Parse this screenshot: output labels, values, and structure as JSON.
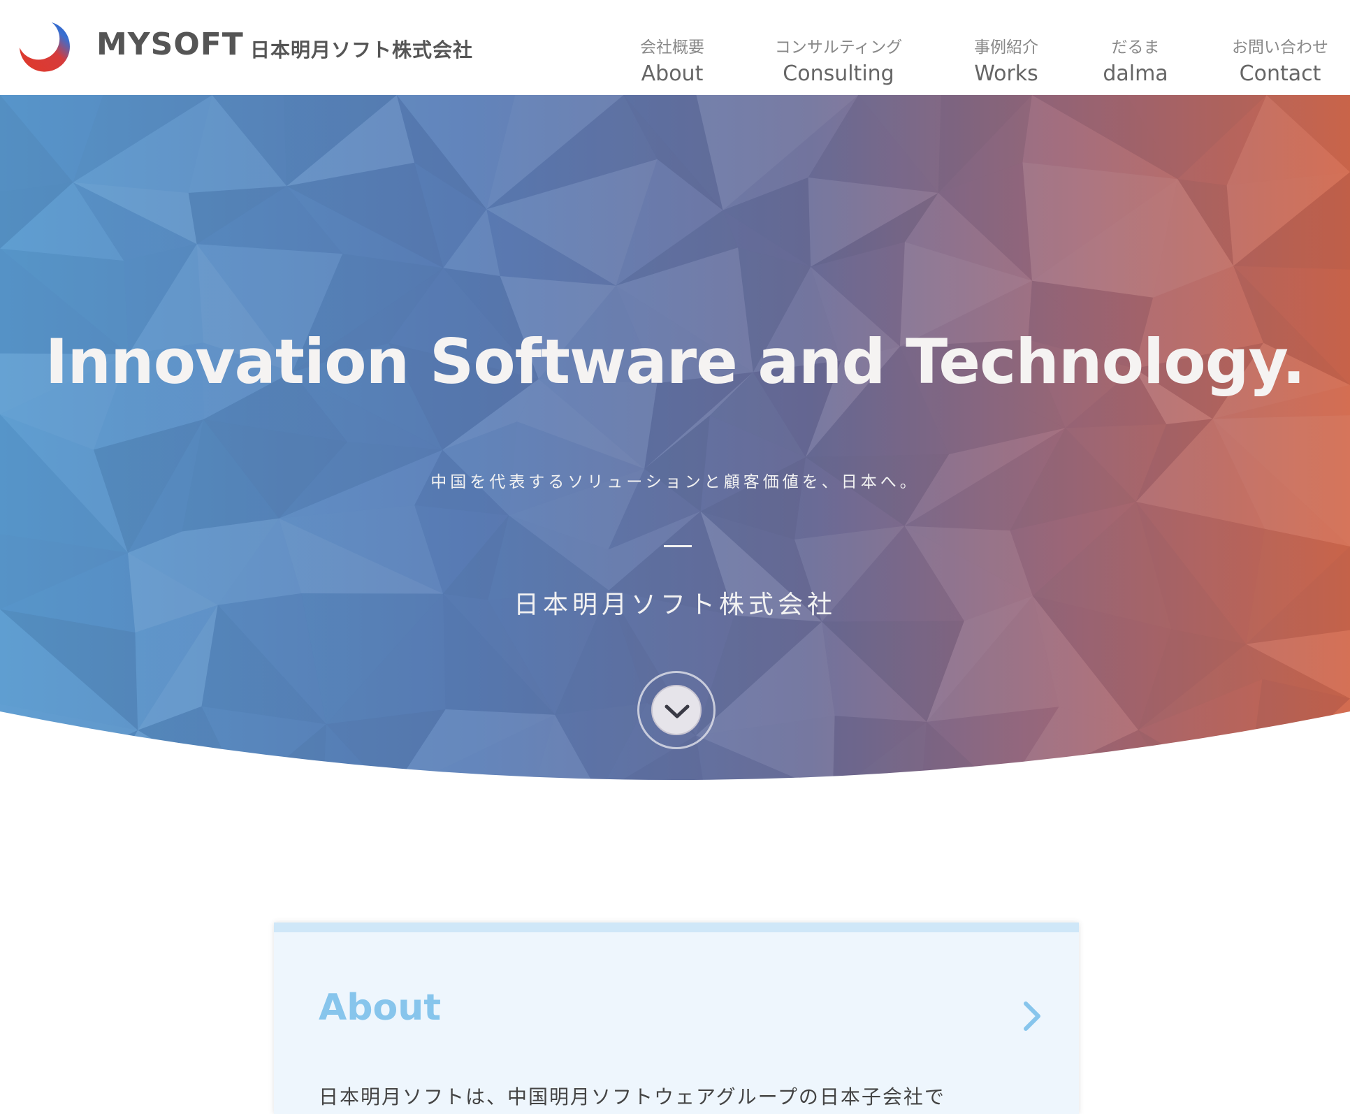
{
  "header": {
    "brand": "MYSOFT",
    "company_jp": "日本明月ソフト株式会社",
    "nav": [
      {
        "jp": "会社概要",
        "en": "About"
      },
      {
        "jp": "コンサルティング",
        "en": "Consulting"
      },
      {
        "jp": "事例紹介",
        "en": "Works"
      },
      {
        "jp": "だるま",
        "en": "dalma"
      },
      {
        "jp": "お問い合わせ",
        "en": "Contact"
      }
    ]
  },
  "hero": {
    "title": "Innovation Software and Technology.",
    "subtitle": "中国を代表するソリューションと顧客価値を、日本へ。",
    "company": "日本明月ソフト株式会社",
    "scroll_icon": "chevron-down-icon"
  },
  "about": {
    "title": "About",
    "text": "日本明月ソフトは、中国明月ソフトウェアグループの日本子会社で",
    "arrow_icon": "chevron-right-icon"
  },
  "colors": {
    "hero_left": "#5a9bd0",
    "hero_right": "#d2674a",
    "about_title": "#87c5ec",
    "about_bg": "#eef6fd"
  }
}
